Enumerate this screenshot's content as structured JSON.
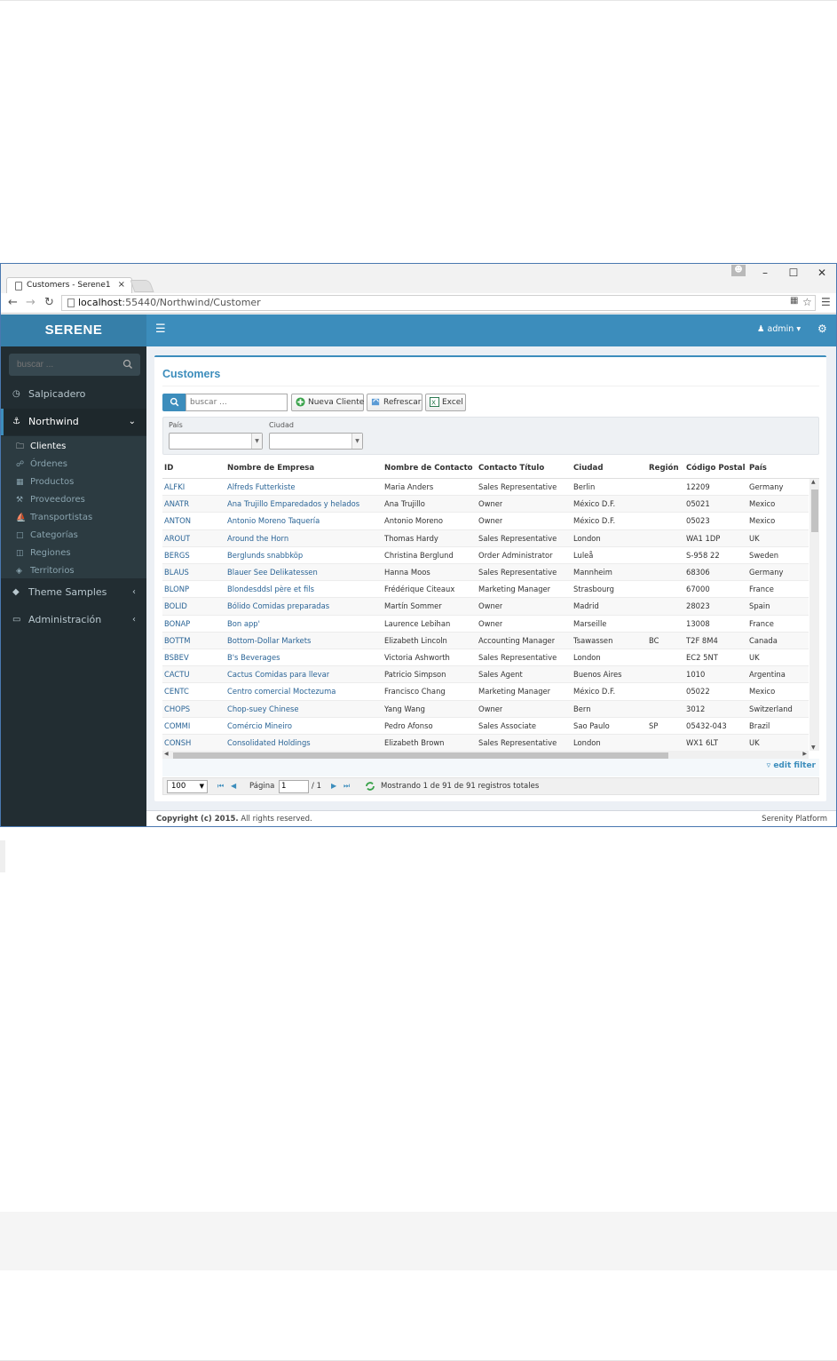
{
  "browser": {
    "tab_title": "Customers - Serene1",
    "tab_close": "×",
    "url_host": "localhost",
    "url_rest": ":55440/Northwind/Customer",
    "win_minimize": "–",
    "win_maximize": "☐",
    "win_close": "✕"
  },
  "app": {
    "logo": "SERENE",
    "sidebar_search_placeholder": "buscar ...",
    "menu": [
      {
        "label": "Salpicadero",
        "icon": "dashboard-icon"
      },
      {
        "label": "Northwind",
        "icon": "anchor-icon"
      },
      {
        "label": "Theme Samples",
        "icon": "diamond-icon"
      },
      {
        "label": "Administración",
        "icon": "desktop-icon"
      }
    ],
    "submenu": [
      {
        "label": "Clientes",
        "icon": "folder-icon"
      },
      {
        "label": "Órdenes",
        "icon": "cart-icon"
      },
      {
        "label": "Productos",
        "icon": "table-icon"
      },
      {
        "label": "Proveedores",
        "icon": "wrench-icon"
      },
      {
        "label": "Transportistas",
        "icon": "ship-icon"
      },
      {
        "label": "Categorías",
        "icon": "folder-open-icon"
      },
      {
        "label": "Regiones",
        "icon": "columns-icon"
      },
      {
        "label": "Territorios",
        "icon": "tags-icon"
      }
    ],
    "topbar": {
      "user": "admin"
    },
    "panel": {
      "title": "Customers",
      "search_placeholder": "buscar ...",
      "buttons": {
        "new": "Nueva Cliente",
        "refresh": "Refrescar",
        "excel": "Excel"
      },
      "filters": {
        "country_label": "País",
        "city_label": "Ciudad"
      }
    },
    "grid": {
      "columns": [
        "ID",
        "Nombre de Empresa",
        "Nombre de Contacto",
        "Contacto Título",
        "Ciudad",
        "Región",
        "Código Postal",
        "País"
      ],
      "rows": [
        [
          "ALFKI",
          "Alfreds Futterkiste",
          "Maria Anders",
          "Sales Representative",
          "Berlin",
          "",
          "12209",
          "Germany"
        ],
        [
          "ANATR",
          "Ana Trujillo Emparedados y helados",
          "Ana Trujillo",
          "Owner",
          "México D.F.",
          "",
          "05021",
          "Mexico"
        ],
        [
          "ANTON",
          "Antonio Moreno Taquería",
          "Antonio Moreno",
          "Owner",
          "México D.F.",
          "",
          "05023",
          "Mexico"
        ],
        [
          "AROUT",
          "Around the Horn",
          "Thomas Hardy",
          "Sales Representative",
          "London",
          "",
          "WA1 1DP",
          "UK"
        ],
        [
          "BERGS",
          "Berglunds snabbköp",
          "Christina Berglund",
          "Order Administrator",
          "Luleå",
          "",
          "S-958 22",
          "Sweden"
        ],
        [
          "BLAUS",
          "Blauer See Delikatessen",
          "Hanna Moos",
          "Sales Representative",
          "Mannheim",
          "",
          "68306",
          "Germany"
        ],
        [
          "BLONP",
          "Blondesddsl père et fils",
          "Frédérique Citeaux",
          "Marketing Manager",
          "Strasbourg",
          "",
          "67000",
          "France"
        ],
        [
          "BOLID",
          "Bólido Comidas preparadas",
          "Martín Sommer",
          "Owner",
          "Madrid",
          "",
          "28023",
          "Spain"
        ],
        [
          "BONAP",
          "Bon app'",
          "Laurence Lebihan",
          "Owner",
          "Marseille",
          "",
          "13008",
          "France"
        ],
        [
          "BOTTM",
          "Bottom-Dollar Markets",
          "Elizabeth Lincoln",
          "Accounting Manager",
          "Tsawassen",
          "BC",
          "T2F 8M4",
          "Canada"
        ],
        [
          "BSBEV",
          "B's Beverages",
          "Victoria Ashworth",
          "Sales Representative",
          "London",
          "",
          "EC2 5NT",
          "UK"
        ],
        [
          "CACTU",
          "Cactus Comidas para llevar",
          "Patricio Simpson",
          "Sales Agent",
          "Buenos Aires",
          "",
          "1010",
          "Argentina"
        ],
        [
          "CENTC",
          "Centro comercial Moctezuma",
          "Francisco Chang",
          "Marketing Manager",
          "México D.F.",
          "",
          "05022",
          "Mexico"
        ],
        [
          "CHOPS",
          "Chop-suey Chinese",
          "Yang Wang",
          "Owner",
          "Bern",
          "",
          "3012",
          "Switzerland"
        ],
        [
          "COMMI",
          "Comércio Mineiro",
          "Pedro Afonso",
          "Sales Associate",
          "Sao Paulo",
          "SP",
          "05432-043",
          "Brazil"
        ],
        [
          "CONSH",
          "Consolidated Holdings",
          "Elizabeth Brown",
          "Sales Representative",
          "London",
          "",
          "WX1 6LT",
          "UK"
        ]
      ]
    },
    "edit_filter": "edit filter",
    "pager": {
      "page_size": "100",
      "page_label": "Página",
      "page_value": "1",
      "page_total": "/ 1",
      "status": "Mostrando 1 de 91 de 91 registros totales"
    },
    "footer": {
      "copyright_bold": "Copyright (c) 2015.",
      "copyright_rest": " All rights reserved.",
      "right": "Serenity Platform"
    }
  }
}
